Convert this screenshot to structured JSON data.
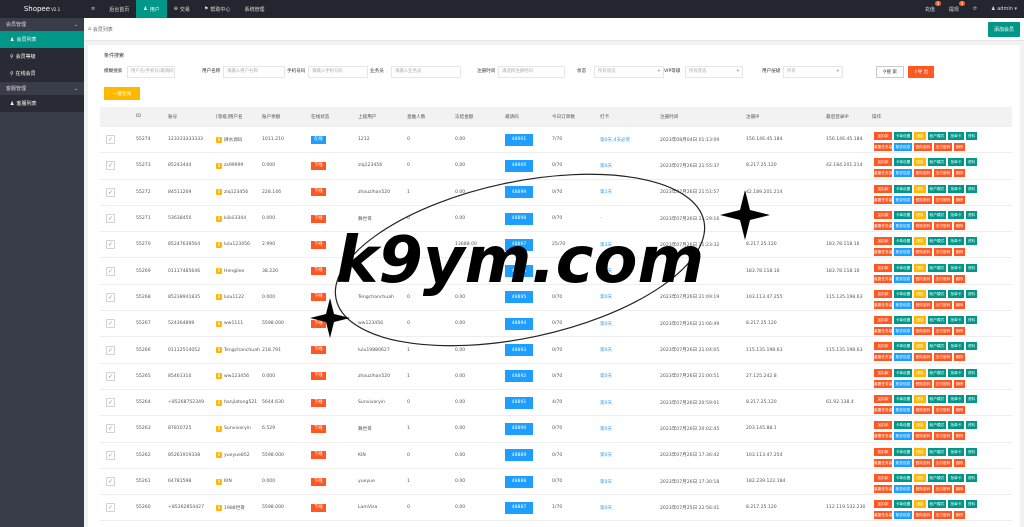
{
  "brand": {
    "name": "Shopee",
    "version": "V2.1"
  },
  "topnav": [
    {
      "icon": "≡",
      "label": ""
    },
    {
      "icon": "",
      "label": "后台首页"
    },
    {
      "icon": "♟",
      "label": "用户"
    },
    {
      "icon": "⊕",
      "label": "交易"
    },
    {
      "icon": "⚑",
      "label": "帮助中心"
    },
    {
      "icon": "",
      "label": "系统管理"
    }
  ],
  "topright": {
    "recharge": "充值",
    "recharge_badge": "0",
    "withdraw": "提现",
    "withdraw_badge": "0",
    "refresh": "⟳",
    "user": "admin"
  },
  "sidebar": {
    "group1": "会员管理",
    "items1": [
      {
        "icon": "♟",
        "label": "会员列表"
      },
      {
        "icon": "⚲",
        "label": "会员等级"
      },
      {
        "icon": "⚲",
        "label": "在线会员"
      }
    ],
    "group2": "客服管理",
    "items2": [
      {
        "icon": "♟",
        "label": "客服列表"
      }
    ]
  },
  "tab": {
    "label": "会员列表"
  },
  "add_button": "添加会员",
  "search": {
    "title": "条件搜索",
    "fields": [
      {
        "label": "模糊搜索",
        "placeholder": "用户名/手机号/邀请码"
      },
      {
        "label": "用户名称",
        "placeholder": "请输入用户名称"
      },
      {
        "label": "手机号码",
        "placeholder": "请输入手机号码"
      },
      {
        "label": "业务员",
        "placeholder": "请输入业务员"
      },
      {
        "label": "注册时间",
        "placeholder": "请选择注册时间"
      },
      {
        "label": "状态",
        "placeholder": "所有状态"
      },
      {
        "label": "VIP等级",
        "placeholder": "所有状态"
      },
      {
        "label": "用户层级",
        "placeholder": "所有"
      }
    ],
    "search_btn": "搜 索",
    "export_btn": "导 出"
  },
  "checkin_btn": "一键签到",
  "table": {
    "columns": [
      "ID",
      "账号",
      "[等级]用户名",
      "账户余额",
      "在线状态",
      "上级用户",
      "直推人数",
      "冻结金额",
      "邀请码",
      "今日订单数",
      "打卡",
      "注册时间",
      "注册IP",
      "最后登录IP",
      "操作"
    ],
    "rows": [
      {
        "id": "55274",
        "account": "123333333333",
        "level": "0",
        "username": "肆水源码",
        "balance": "1011.210",
        "status": "在线",
        "online": true,
        "parent": "1212",
        "direct": "0",
        "frozen": "0.00",
        "invite": "48901",
        "orders": "7/70",
        "checkin": "第0天,4天必奖",
        "reg_time": "2023年08月04日 01:13:09",
        "reg_ip": "156.146.45.184",
        "last_ip": "156.146.45.184"
      },
      {
        "id": "55273",
        "account": "85243444",
        "level": "0",
        "username": "zz99999",
        "balance": "0.000",
        "status": "下线",
        "online": false,
        "parent": "zlq123456",
        "direct": "0",
        "frozen": "0.00",
        "invite": "48900",
        "orders": "0/70",
        "checkin": "第0天",
        "reg_time": "2023年07月26日 21:55:37",
        "reg_ip": "8.217.25.120",
        "last_ip": "42.184.201.214"
      },
      {
        "id": "55272",
        "account": "84511269",
        "level": "0",
        "username": "zlq123456",
        "balance": "228.146",
        "status": "下线",
        "online": false,
        "parent": "zhouzihan520",
        "direct": "1",
        "frozen": "0.00",
        "invite": "48899",
        "orders": "0/70",
        "checkin": "第1天",
        "reg_time": "2023年07月26日 21:51:57",
        "reg_ip": "42.189.201.214",
        "last_ip": ""
      },
      {
        "id": "55271",
        "account": "53638450",
        "level": "0",
        "username": "kiikii3344",
        "balance": "0.000",
        "status": "下线",
        "online": false,
        "parent": "舞世哥",
        "direct": "0",
        "frozen": "0.00",
        "invite": "48898",
        "orders": "0/70",
        "checkin": "-",
        "reg_time": "2023年07月26日 21:29:16",
        "reg_ip": "",
        "last_ip": ""
      },
      {
        "id": "55270",
        "account": "85247639564",
        "level": "0",
        "username": "lulu123456",
        "balance": "2.990",
        "status": "下线",
        "online": false,
        "parent": "",
        "direct": "0",
        "frozen": "13688.00",
        "invite": "48897",
        "orders": "25/70",
        "checkin": "第3天",
        "reg_time": "2023年07月26日 21:23:32",
        "reg_ip": "8.217.25.120",
        "last_ip": "183.78.118.16"
      },
      {
        "id": "55269",
        "account": "01117485646",
        "level": "0",
        "username": "Hengilee",
        "balance": "38.220",
        "status": "下线",
        "online": false,
        "parent": "",
        "direct": "",
        "frozen": "",
        "invite": "48896",
        "orders": "",
        "checkin": "第0天",
        "reg_time": "",
        "reg_ip": "183.78.118.16",
        "last_ip": "183.78.118.16"
      },
      {
        "id": "55268",
        "account": "85238941835",
        "level": "0",
        "username": "lulu1122",
        "balance": "0.000",
        "status": "下线",
        "online": false,
        "parent": "Tengchanchuah",
        "direct": "0",
        "frozen": "0.00",
        "invite": "48895",
        "orders": "0/70",
        "checkin": "第0天",
        "reg_time": "2023年07月26日 21:09:19",
        "reg_ip": "103.113.47.255",
        "last_ip": "115.135.198.63"
      },
      {
        "id": "55267",
        "account": "524364899",
        "level": "0",
        "username": "ww1111",
        "balance": "5598.000",
        "status": "下线",
        "online": false,
        "parent": "ww123456",
        "direct": "0",
        "frozen": "0.00",
        "invite": "48894",
        "orders": "0/70",
        "checkin": "第0天",
        "reg_time": "2023年07月26日 21:06:49",
        "reg_ip": "8.217.25.120",
        "last_ip": ""
      },
      {
        "id": "55266",
        "account": "01112514052",
        "level": "0",
        "username": "Tengchanchuah",
        "balance": "218.791",
        "status": "下线",
        "online": false,
        "parent": "lulu19880627",
        "direct": "1",
        "frozen": "0.00",
        "invite": "48893",
        "orders": "0/70",
        "checkin": "第0天",
        "reg_time": "2023年07月26日 21:04:05",
        "reg_ip": "115.135.198.63",
        "last_ip": "115.135.198.63"
      },
      {
        "id": "55265",
        "account": "85461310",
        "level": "0",
        "username": "ww123456",
        "balance": "0.000",
        "status": "下线",
        "online": false,
        "parent": "zhouzihan520",
        "direct": "1",
        "frozen": "0.00",
        "invite": "48892",
        "orders": "0/70",
        "checkin": "第0天",
        "reg_time": "2023年07月26日 21:00:51",
        "reg_ip": "27.125.242.8",
        "last_ip": ""
      },
      {
        "id": "55264",
        "account": "+85268752349",
        "level": "0",
        "username": "hanjiatong521",
        "balance": "5644.630",
        "status": "下线",
        "online": false,
        "parent": "Sunvivoryin",
        "direct": "0",
        "frozen": "0.00",
        "invite": "48891",
        "orders": "4/70",
        "checkin": "第0天",
        "reg_time": "2023年07月26日 20:59:01",
        "reg_ip": "8.217.25.120",
        "last_ip": "61.92.138.4"
      },
      {
        "id": "55263",
        "account": "87810725",
        "level": "0",
        "username": "Sunvivoryin",
        "balance": "6.529",
        "status": "下线",
        "online": false,
        "parent": "舞世哥",
        "direct": "1",
        "frozen": "0.00",
        "invite": "48890",
        "orders": "0/70",
        "checkin": "第0天",
        "reg_time": "2023年07月26日 20:02:45",
        "reg_ip": "203.145.88.1",
        "last_ip": ""
      },
      {
        "id": "55262",
        "account": "85261919338",
        "level": "0",
        "username": "yueyue852",
        "balance": "5598.000",
        "status": "下线",
        "online": false,
        "parent": "KIN",
        "direct": "0",
        "frozen": "0.00",
        "invite": "48889",
        "orders": "0/70",
        "checkin": "第0天",
        "reg_time": "2023年07月26日 17:36:42",
        "reg_ip": "103.113.47.254",
        "last_ip": ""
      },
      {
        "id": "55261",
        "account": "64781598",
        "level": "0",
        "username": "KIN",
        "balance": "0.000",
        "status": "下线",
        "online": false,
        "parent": "yueyue",
        "direct": "1",
        "frozen": "0.00",
        "invite": "48888",
        "orders": "0/70",
        "checkin": "第0天",
        "reg_time": "2023年07月26日 17:30:18",
        "reg_ip": "182.239.122.184",
        "last_ip": ""
      },
      {
        "id": "55260",
        "account": "+85262854427",
        "level": "0",
        "username": "1988世哥",
        "balance": "5598.000",
        "status": "下线",
        "online": false,
        "parent": "LamVisa",
        "direct": "0",
        "frozen": "0.00",
        "invite": "48887",
        "orders": "1/70",
        "checkin": "第0天",
        "reg_time": "2023年07月25日 22:56:41",
        "reg_ip": "8.217.25.120",
        "last_ip": "112.119.132.230"
      }
    ],
    "ops": [
      {
        "label": "加扣款",
        "color": "#ff5722"
      },
      {
        "label": "卡单设置",
        "color": "#009688"
      },
      {
        "label": "团队",
        "color": "#ffb800"
      },
      {
        "label": "帐户模式",
        "color": "#009688"
      },
      {
        "label": "抢单卡",
        "color": "#009688"
      },
      {
        "label": "资料",
        "color": "#009688"
      },
      {
        "label": "重置任务量",
        "color": "#ff5722"
      },
      {
        "label": "账变信息",
        "color": "#1e9fff"
      },
      {
        "label": "登陆密码",
        "color": "#ff5722"
      },
      {
        "label": "支付密码",
        "color": "#ff5722"
      },
      {
        "label": "删除",
        "color": "#ff5722"
      }
    ]
  },
  "watermark": "k9ym.com"
}
